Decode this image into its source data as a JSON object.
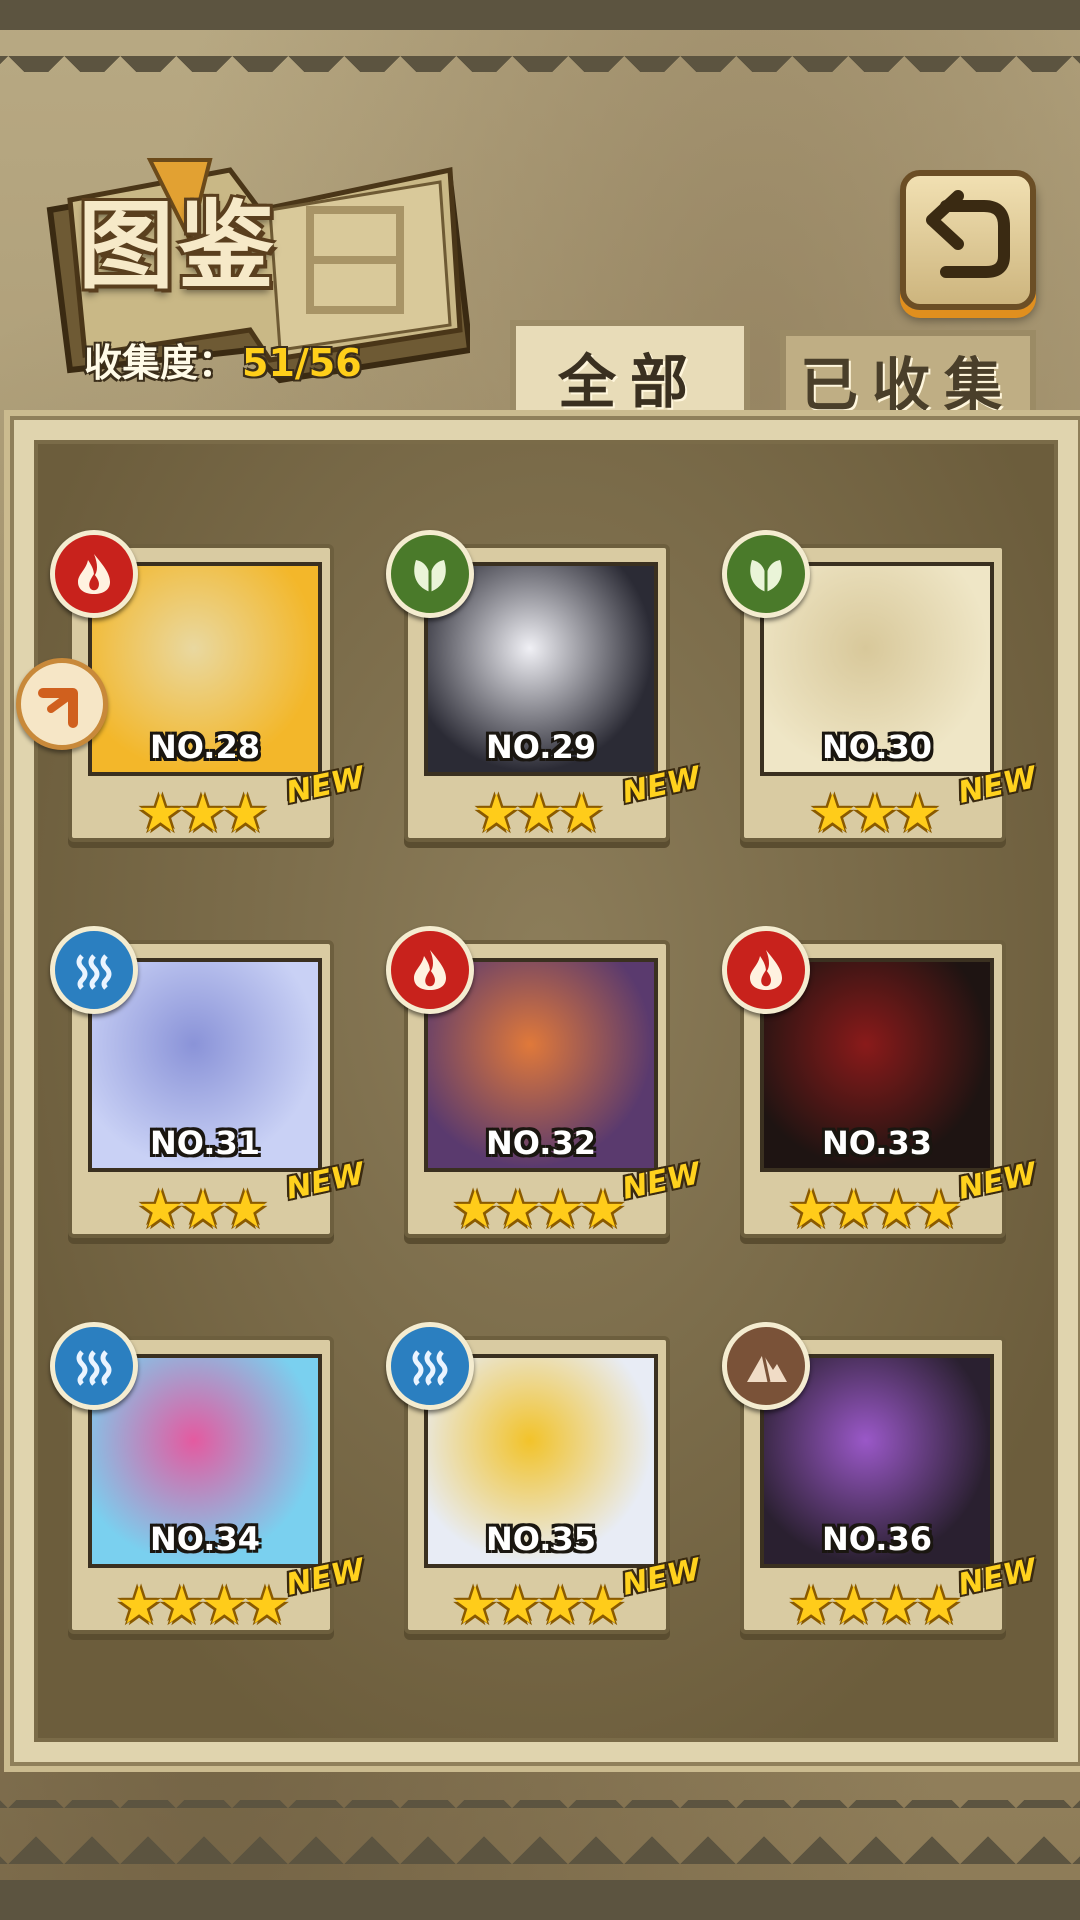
{
  "header": {
    "title": "图鉴",
    "collection_label": "收集度：",
    "collection_value": "51/56"
  },
  "tabs": [
    {
      "label": "全部",
      "active": true
    },
    {
      "label": "已收集",
      "active": false
    }
  ],
  "cards": [
    {
      "number": "NO.28",
      "element": "fire",
      "stars": "★★★",
      "new": "NEW",
      "colors": [
        "#f3b72a",
        "#e9d8a0"
      ]
    },
    {
      "number": "NO.29",
      "element": "grass",
      "stars": "★★★",
      "new": "NEW",
      "colors": [
        "#2b2b35",
        "#f0f0f5"
      ]
    },
    {
      "number": "NO.30",
      "element": "grass",
      "stars": "★★★",
      "new": "NEW",
      "colors": [
        "#efe6c6",
        "#d8c89a"
      ]
    },
    {
      "number": "NO.31",
      "element": "water",
      "stars": "★★★",
      "new": "NEW",
      "colors": [
        "#c9d1f5",
        "#8a93d8"
      ]
    },
    {
      "number": "NO.32",
      "element": "fire",
      "stars": "★★★★",
      "new": "NEW",
      "colors": [
        "#5a3a6e",
        "#e0793a"
      ]
    },
    {
      "number": "NO.33",
      "element": "fire",
      "stars": "★★★★",
      "new": "NEW",
      "colors": [
        "#1e1412",
        "#8a1a1a"
      ]
    },
    {
      "number": "NO.34",
      "element": "water",
      "stars": "★★★★",
      "new": "NEW",
      "colors": [
        "#7ad0ef",
        "#e45aa0"
      ]
    },
    {
      "number": "NO.35",
      "element": "water",
      "stars": "★★★★",
      "new": "NEW",
      "colors": [
        "#e8ecf5",
        "#f2c32a"
      ]
    },
    {
      "number": "NO.36",
      "element": "earth",
      "stars": "★★★★",
      "new": "",
      "colors": [
        "#2a2030",
        "#9a58c8"
      ]
    }
  ],
  "card_36_new": "NEW",
  "icons": {
    "fire": "flame-icon",
    "grass": "leaf-icon",
    "water": "water-waves-icon",
    "earth": "mountain-icon",
    "back": "return-arrow-icon"
  }
}
